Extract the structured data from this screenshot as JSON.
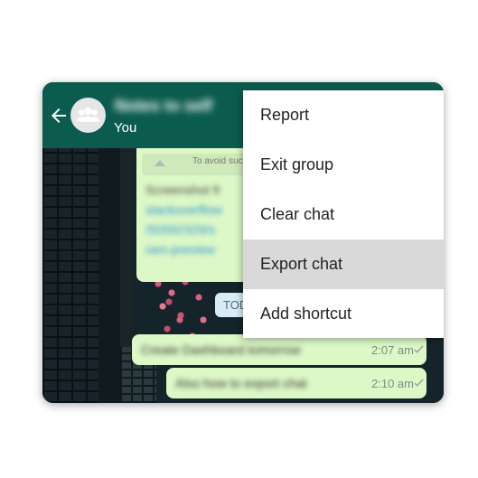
{
  "appbar": {
    "title": "Notes to self",
    "subtitle": "You",
    "back_icon": "arrow-left-icon",
    "avatar_icon": "group-icon"
  },
  "chat": {
    "link_message": {
      "preview_text": "To avoid such",
      "lines": [
        "Screenshot fr",
        "stackoverflow",
        "/50592329/s",
        "ram-preview"
      ]
    },
    "day_label": "TODAY",
    "messages": [
      {
        "text": "Create Dashboard tomorrow",
        "time": "2:07 am",
        "status_icon": "check-icon"
      },
      {
        "text": "Also how to export chat",
        "time": "2:10 am",
        "status_icon": "check-icon"
      }
    ]
  },
  "menu": {
    "items": [
      {
        "label": "Report"
      },
      {
        "label": "Exit group"
      },
      {
        "label": "Clear chat"
      },
      {
        "label": "Export chat",
        "highlighted": true
      },
      {
        "label": "Add shortcut"
      }
    ]
  },
  "colors": {
    "appbar": "#0b5b4f",
    "bubble": "#dcf8c6",
    "menu_highlight": "#d9d9d9"
  }
}
